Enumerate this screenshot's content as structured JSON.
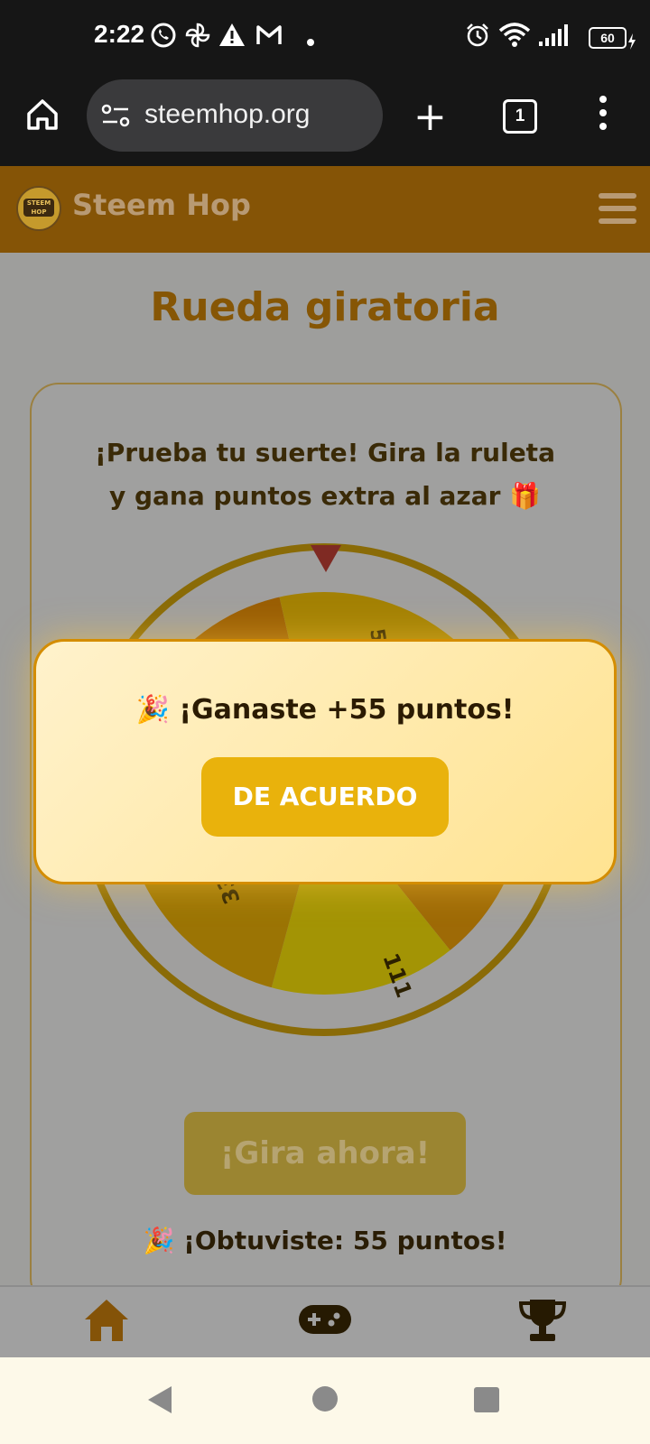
{
  "status_bar": {
    "time": "2:22",
    "battery": "60",
    "icons": [
      "whatsapp-icon",
      "pinwheel-icon",
      "warning-icon",
      "gmail-icon",
      "dot-icon",
      "alarm-icon",
      "wifi-icon",
      "signal-icon",
      "battery-icon",
      "charging-icon"
    ]
  },
  "browser": {
    "url": "steemhop.org",
    "tab_count": "1"
  },
  "site": {
    "name": "Steem Hop",
    "logo_text": "STEEM HOP"
  },
  "page": {
    "title": "Rueda giratoria",
    "intro": "¡Prueba tu suerte! Gira la ruleta y gana puntos extra al azar 🎁",
    "wheel_labels": [
      "111 pts",
      "333 pts",
      "55 pts"
    ],
    "spin_button": "¡Gira ahora!",
    "result": "🎉 ¡Obtuviste: 55 puntos!"
  },
  "modal": {
    "message": "🎉 ¡Ganaste +55 puntos!",
    "ok_button": "DE ACUERDO"
  },
  "bottom_nav": [
    "home-icon",
    "gamepad-icon",
    "trophy-icon"
  ],
  "colors": {
    "header_brown": "#855406",
    "accent_gold": "#e9b20c",
    "modal_border": "#d48d00",
    "title_color": "#865605"
  }
}
